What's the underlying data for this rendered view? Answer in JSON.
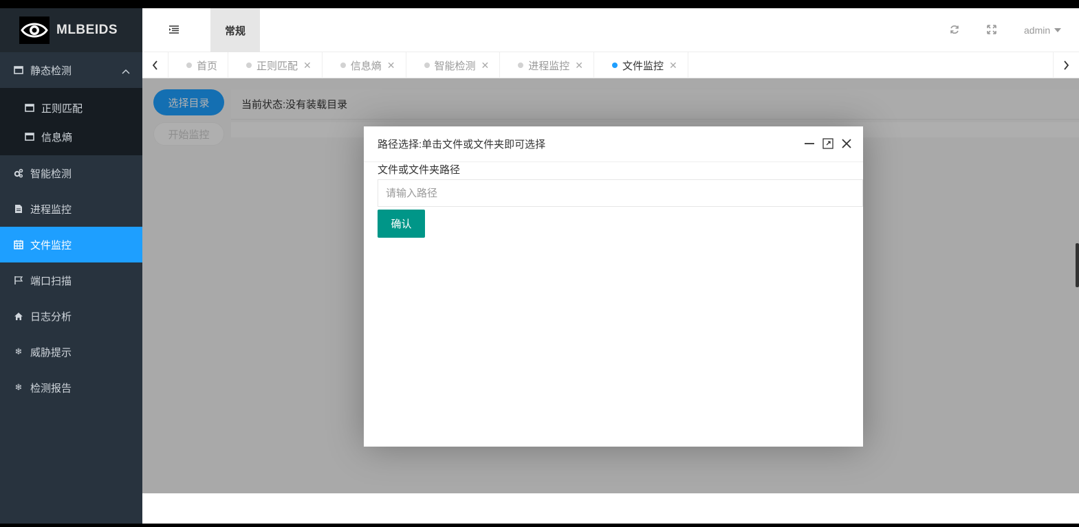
{
  "app": {
    "logo_text": "MLBEIDS"
  },
  "header": {
    "top_tab": "常规",
    "user": "admin"
  },
  "sidebar": {
    "items": [
      {
        "label": "静态检测",
        "icon": "window-icon",
        "expanded": true
      },
      {
        "label": "智能检测",
        "icon": "gears-icon"
      },
      {
        "label": "进程监控",
        "icon": "file-icon"
      },
      {
        "label": "文件监控",
        "icon": "calendar-icon",
        "active": true
      },
      {
        "label": "端口扫描",
        "icon": "flag-icon"
      },
      {
        "label": "日志分析",
        "icon": "home-icon"
      },
      {
        "label": "威胁提示",
        "icon": "snowflake-icon"
      },
      {
        "label": "检测报告",
        "icon": "snowflake-icon"
      }
    ],
    "subitems": [
      {
        "label": "正则匹配",
        "icon": "window-icon"
      },
      {
        "label": "信息熵",
        "icon": "window-icon"
      }
    ]
  },
  "tabs": [
    {
      "label": "首页",
      "closable": false
    },
    {
      "label": "正则匹配",
      "closable": true
    },
    {
      "label": "信息熵",
      "closable": true
    },
    {
      "label": "智能检测",
      "closable": true
    },
    {
      "label": "进程监控",
      "closable": true
    },
    {
      "label": "文件监控",
      "closable": true,
      "active": true
    }
  ],
  "main": {
    "select_dir_label": "选择目录",
    "start_monitor_label": "开始监控",
    "status_text": "当前状态:没有装载目录"
  },
  "dialog": {
    "title": "路径选择:单击文件或文件夹即可选择",
    "field_label": "文件或文件夹路径",
    "input_placeholder": "请输入路径",
    "input_value": "",
    "confirm_label": "确认"
  },
  "colors": {
    "sidebar_bg": "#28333e",
    "accent_blue": "#1e9fff",
    "confirm_green": "#009688"
  }
}
